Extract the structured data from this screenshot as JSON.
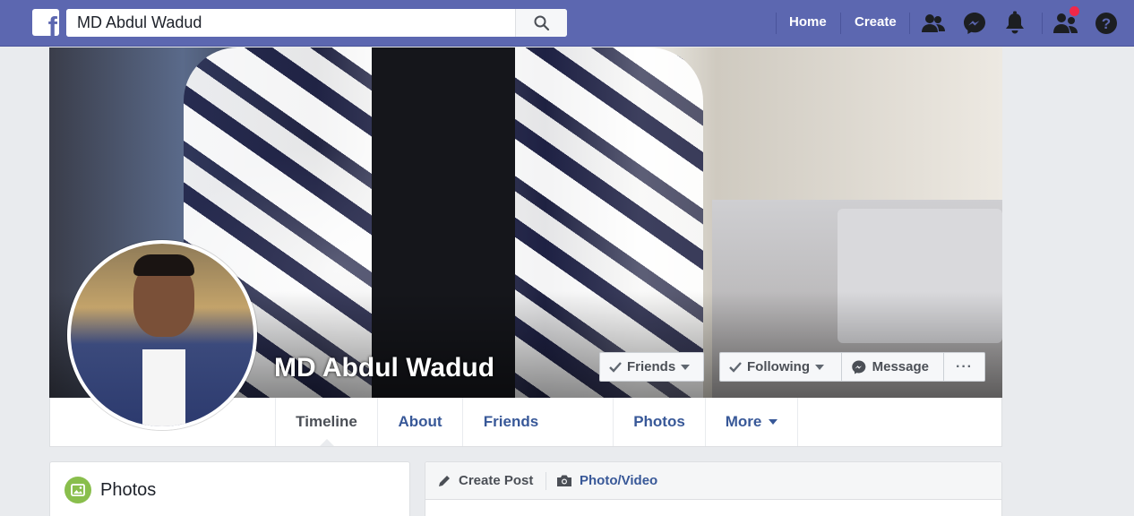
{
  "topbar": {
    "logo": "f",
    "search_value": "MD Abdul Wadud",
    "nav_home": "Home",
    "nav_create": "Create",
    "icons": [
      "friends-icon",
      "messenger-icon",
      "notifications-icon",
      "friend-requests-icon",
      "help-icon"
    ]
  },
  "profile": {
    "name": "MD Abdul Wadud",
    "friends_button": "Friends",
    "following_button": "Following",
    "message_button": "Message",
    "more_button": "···"
  },
  "tabs": [
    {
      "label": "Timeline"
    },
    {
      "label": "About"
    },
    {
      "label": "Friends"
    },
    {
      "label": "Photos"
    },
    {
      "label": "More"
    }
  ],
  "photos_card": {
    "title": "Photos"
  },
  "composer": {
    "create_post": "Create Post",
    "photo_video": "Photo/Video"
  },
  "colors": {
    "topbar": "#5c67b0",
    "link": "#385898",
    "notification": "#f02849"
  }
}
